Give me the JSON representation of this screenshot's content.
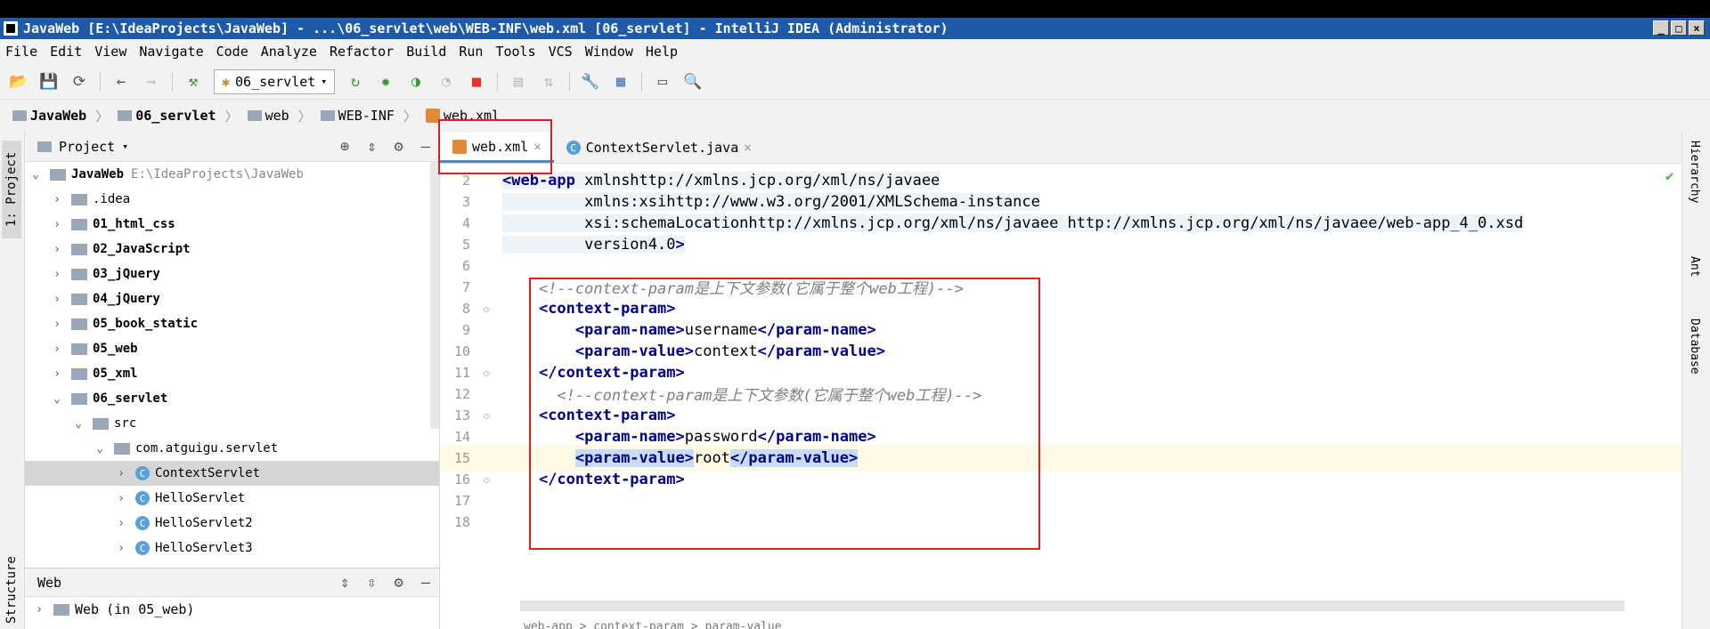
{
  "window": {
    "title": "JavaWeb [E:\\IdeaProjects\\JavaWeb] - ...\\06_servlet\\web\\WEB-INF\\web.xml [06_servlet] - IntelliJ IDEA (Administrator)",
    "buttons": [
      "_",
      "□",
      "×"
    ]
  },
  "menu": [
    "File",
    "Edit",
    "View",
    "Navigate",
    "Code",
    "Analyze",
    "Refactor",
    "Build",
    "Run",
    "Tools",
    "VCS",
    "Window",
    "Help"
  ],
  "toolbar": {
    "run_config": "06_servlet",
    "icons": [
      "open-icon",
      "save-icon",
      "sync-icon",
      "back-icon",
      "forward-icon",
      "build-hammer-icon",
      "run-icon",
      "debug-icon",
      "coverage-icon",
      "profile-icon",
      "stop-icon",
      "attach-icon",
      "update-icon",
      "settings-wrench-icon",
      "project-structure-icon",
      "terminal-icon",
      "search-icon"
    ]
  },
  "breadcrumbs": [
    "JavaWeb",
    "06_servlet",
    "web",
    "WEB-INF",
    "web.xml"
  ],
  "left_strip": {
    "project_tab": "1: Project",
    "structure_tab": "Structure"
  },
  "project_panel": {
    "title": "Project",
    "tree": [
      {
        "label": "JavaWeb",
        "extra": "E:\\IdeaProjects\\JavaWeb",
        "depth": 0,
        "expanded": true,
        "bold": true
      },
      {
        "label": ".idea",
        "depth": 1,
        "expanded": false
      },
      {
        "label": "01_html_css",
        "depth": 1,
        "expanded": false,
        "bold": true
      },
      {
        "label": "02_JavaScript",
        "depth": 1,
        "expanded": false,
        "bold": true
      },
      {
        "label": "03_jQuery",
        "depth": 1,
        "expanded": false,
        "bold": true
      },
      {
        "label": "04_jQuery",
        "depth": 1,
        "expanded": false,
        "bold": true
      },
      {
        "label": "05_book_static",
        "depth": 1,
        "expanded": false,
        "bold": true
      },
      {
        "label": "05_web",
        "depth": 1,
        "expanded": false,
        "bold": true
      },
      {
        "label": "05_xml",
        "depth": 1,
        "expanded": false,
        "bold": true
      },
      {
        "label": "06_servlet",
        "depth": 1,
        "expanded": true,
        "bold": true
      },
      {
        "label": "src",
        "depth": 2,
        "expanded": true
      },
      {
        "label": "com.atguigu.servlet",
        "depth": 3,
        "expanded": true
      },
      {
        "label": "ContextServlet",
        "depth": 4,
        "expanded": false,
        "class": true,
        "selected": true
      },
      {
        "label": "HelloServlet",
        "depth": 4,
        "expanded": false,
        "class": true
      },
      {
        "label": "HelloServlet2",
        "depth": 4,
        "expanded": false,
        "class": true
      },
      {
        "label": "HelloServlet3",
        "depth": 4,
        "expanded": false,
        "class": true
      }
    ]
  },
  "web_panel": {
    "title": "Web",
    "item": "Web",
    "item_extra": "(in 05_web)"
  },
  "editor": {
    "tabs": [
      {
        "label": "web.xml",
        "active": true
      },
      {
        "label": "ContextServlet.java",
        "active": false
      }
    ],
    "lines": [
      {
        "n": "2",
        "text": "<web-app xmlns=\"http://xmlns.jcp.org/xml/ns/javaee\""
      },
      {
        "n": "3",
        "text": "         xmlns:xsi=\"http://www.w3.org/2001/XMLSchema-instance\""
      },
      {
        "n": "4",
        "text": "         xsi:schemaLocation=\"http://xmlns.jcp.org/xml/ns/javaee http://xmlns.jcp.org/xml/ns/javaee/web-app_4_0.xsd\""
      },
      {
        "n": "5",
        "text": "         version=\"4.0\">"
      },
      {
        "n": "6",
        "text": ""
      },
      {
        "n": "7",
        "text": "    <!--context-param是上下文参数(它属于整个web工程)-->"
      },
      {
        "n": "8",
        "text": "    <context-param>"
      },
      {
        "n": "9",
        "text": "        <param-name>username</param-name>"
      },
      {
        "n": "10",
        "text": "        <param-value>context</param-value>"
      },
      {
        "n": "11",
        "text": "    </context-param>"
      },
      {
        "n": "12",
        "text": "      <!--context-param是上下文参数(它属于整个web工程)-->"
      },
      {
        "n": "13",
        "text": "    <context-param>"
      },
      {
        "n": "14",
        "text": "        <param-name>password</param-name>"
      },
      {
        "n": "15",
        "text": "        <param-value>root</param-value>"
      },
      {
        "n": "16",
        "text": "    </context-param>"
      },
      {
        "n": "17",
        "text": ""
      },
      {
        "n": "18",
        "text": ""
      }
    ],
    "status_path": "web-app  >  context-param  >  param-value"
  },
  "right_strip": [
    "Hierarchy",
    "Ant",
    "Database"
  ]
}
